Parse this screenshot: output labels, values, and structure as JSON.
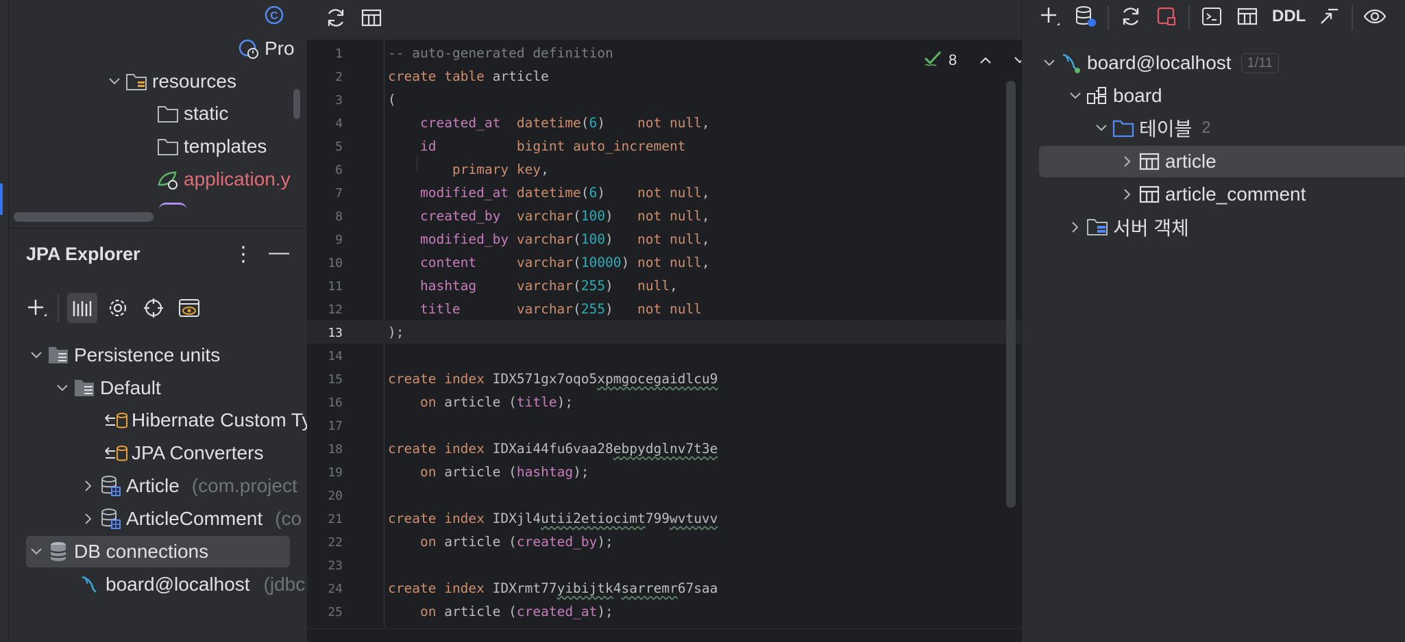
{
  "project_tree": {
    "pro_label": "Pro",
    "resources": "resources",
    "static": "static",
    "templates": "templates",
    "application": "application.y"
  },
  "jpa_explorer": {
    "title": "JPA Explorer",
    "persistence_units": "Persistence units",
    "default": "Default",
    "hibernate_types": "Hibernate Custom Ty",
    "jpa_converters": "JPA Converters",
    "article": "Article",
    "article_pkg": "(com.project",
    "article_comment": "ArticleComment",
    "article_comment_pkg": "(co",
    "db_connections": "DB connections",
    "board_localhost": "board@localhost",
    "board_localhost_url": "(jdbc:"
  },
  "editor": {
    "inspection_count": "8",
    "line_numbers": [
      "1",
      "2",
      "3",
      "4",
      "5",
      "6",
      "7",
      "8",
      "9",
      "10",
      "11",
      "12",
      "13",
      "14",
      "15",
      "16",
      "17",
      "18",
      "19",
      "20",
      "21",
      "22",
      "23",
      "24",
      "25"
    ],
    "current_line": "13",
    "code": {
      "l1": "-- auto-generated definition",
      "create": "create",
      "table": "table",
      "tbl_name": "article",
      "open_paren": "(",
      "close_paren": ");",
      "not_null": "not null",
      "null": "null",
      "primary_key": "primary key",
      "auto_increment": "auto_increment",
      "f_created_at": "created_at",
      "f_id": "id",
      "f_modified_at": "modified_at",
      "f_created_by": "created_by",
      "f_modified_by": "modified_by",
      "f_content": "content",
      "f_hashtag": "hashtag",
      "f_title": "title",
      "t_datetime": "datetime",
      "t_bigint": "bigint",
      "t_varchar": "varchar",
      "n6": "6",
      "n100": "100",
      "n10000": "10000",
      "n255": "255",
      "index": "index",
      "on": "on",
      "idx1_a": "IDX571gx7oqo5",
      "idx1_b": "xpmgocegaidlcu9",
      "idx2_a": "IDXai44fu6vaa28",
      "idx2_b": "ebpydglnv7t3e",
      "idx3_a": "IDXjl4",
      "idx3_b": "utii2etiocimt",
      "idx3_c": "799",
      "idx3_d": "wvtuvv",
      "idx4_a": "IDXrmt77",
      "idx4_b": "yibijtk",
      "idx4_c": "4",
      "idx4_d": "sarremr",
      "idx4_e": "67saa"
    }
  },
  "db_pane": {
    "ddl_label": "DDL",
    "datasource": "board@localhost",
    "datasource_badge": "1/11",
    "schema": "board",
    "tables_folder": "테이블",
    "tables_count": "2",
    "table1": "article",
    "table2": "article_comment",
    "server_objects": "서버 객체"
  },
  "colors": {
    "accent": "#3574f0",
    "keyword": "#cf8e6d",
    "field": "#c77dbb",
    "number": "#2aacb8"
  }
}
